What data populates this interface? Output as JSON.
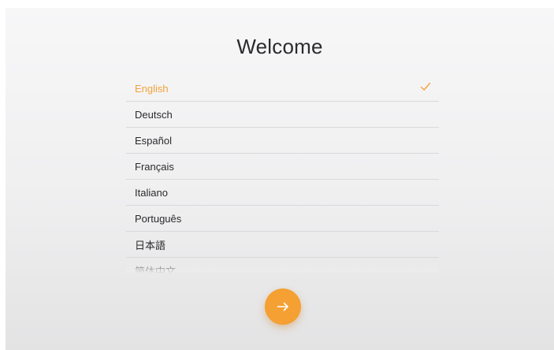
{
  "title": "Welcome",
  "languages": [
    {
      "label": "English",
      "selected": true
    },
    {
      "label": "Deutsch",
      "selected": false
    },
    {
      "label": "Español",
      "selected": false
    },
    {
      "label": "Français",
      "selected": false
    },
    {
      "label": "Italiano",
      "selected": false
    },
    {
      "label": "Português",
      "selected": false
    },
    {
      "label": "日本語",
      "selected": false
    },
    {
      "label": "简体中文",
      "selected": false
    }
  ],
  "selected_icon": "check-icon",
  "next_icon": "arrow-right-icon",
  "colors": {
    "accent": "#f5a032",
    "selected_text": "#f2a33a",
    "text": "#2a2a2d",
    "divider": "#d9d9dc"
  }
}
